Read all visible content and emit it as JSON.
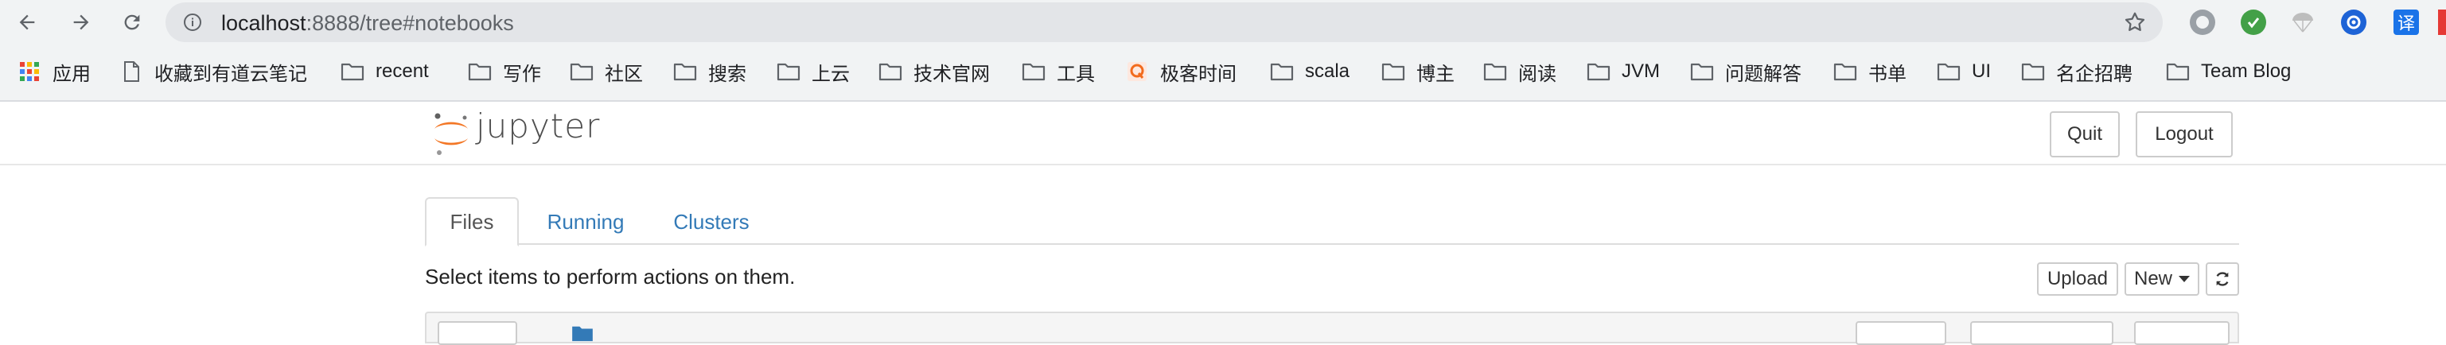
{
  "browser": {
    "url_host": "localhost",
    "url_rest": ":8888/tree#notebooks",
    "nav": [
      "back-icon",
      "forward-icon",
      "reload-icon"
    ],
    "extensions": [
      {
        "name": "circle-gray-icon",
        "color": "#9aa0a6"
      },
      {
        "name": "green-check-icon",
        "color": "#43a047"
      },
      {
        "name": "parachute-icon",
        "color": "#bdbdbd"
      },
      {
        "name": "blue-sync-icon",
        "color": "#1e63d6"
      },
      {
        "name": "translate-icon",
        "color": "#1a73e8",
        "text": "译"
      }
    ]
  },
  "bookmarks": [
    {
      "label": "应用",
      "icon": "apps-grid-icon"
    },
    {
      "label": "收藏到有道云笔记",
      "icon": "page-icon"
    },
    {
      "label": "recent",
      "icon": "folder-icon"
    },
    {
      "label": "写作",
      "icon": "folder-icon"
    },
    {
      "label": "社区",
      "icon": "folder-icon"
    },
    {
      "label": "搜索",
      "icon": "folder-icon"
    },
    {
      "label": "上云",
      "icon": "folder-icon"
    },
    {
      "label": "技术官网",
      "icon": "folder-icon"
    },
    {
      "label": "工具",
      "icon": "folder-icon"
    },
    {
      "label": "极客时间",
      "icon": "geektime-icon"
    },
    {
      "label": "scala",
      "icon": "folder-icon"
    },
    {
      "label": "博主",
      "icon": "folder-icon"
    },
    {
      "label": "阅读",
      "icon": "folder-icon"
    },
    {
      "label": "JVM",
      "icon": "folder-icon"
    },
    {
      "label": "问题解答",
      "icon": "folder-icon"
    },
    {
      "label": "书单",
      "icon": "folder-icon"
    },
    {
      "label": "UI",
      "icon": "folder-icon"
    },
    {
      "label": "名企招聘",
      "icon": "folder-icon"
    },
    {
      "label": "Team Blog",
      "icon": "folder-icon"
    }
  ],
  "jupyter": {
    "logo_text": "jupyter",
    "quit_label": "Quit",
    "logout_label": "Logout",
    "tabs": [
      "Files",
      "Running",
      "Clusters"
    ],
    "hint": "Select items to perform actions on them.",
    "upload_label": "Upload",
    "new_label": "New"
  },
  "colors": {
    "link": "#337ab7",
    "logo_orange": "#f37726"
  }
}
